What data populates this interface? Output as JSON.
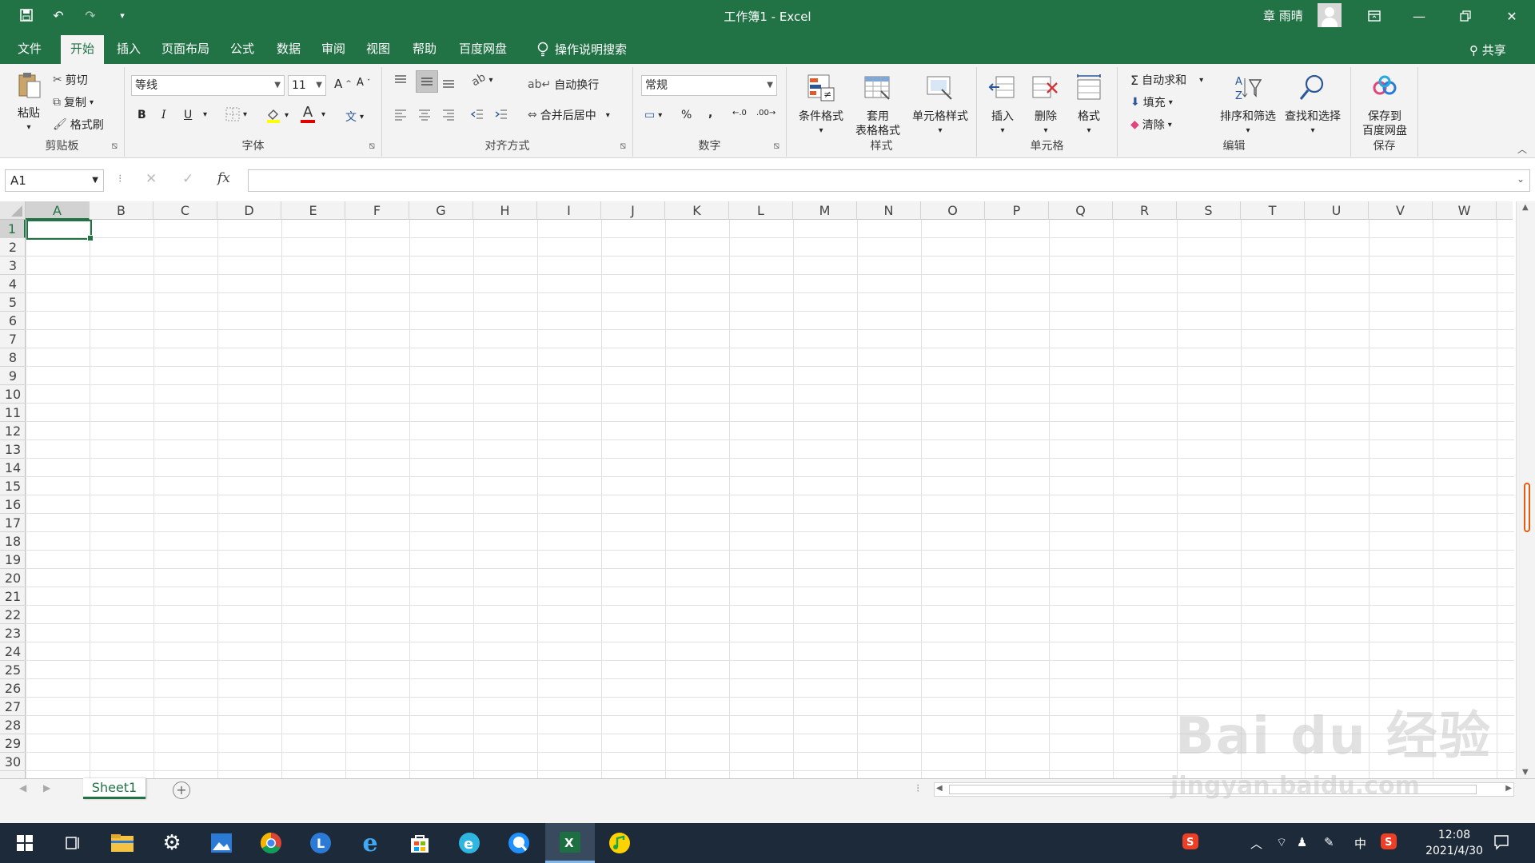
{
  "window": {
    "title": "工作簿1  -  Excel",
    "user": "章 雨晴"
  },
  "tabs": [
    "文件",
    "开始",
    "插入",
    "页面布局",
    "公式",
    "数据",
    "审阅",
    "视图",
    "帮助",
    "百度网盘"
  ],
  "tell_me": "操作说明搜索",
  "share": "共享",
  "ribbon": {
    "clipboard": {
      "label": "剪贴板",
      "paste": "粘贴",
      "cut": "剪切",
      "copy": "复制",
      "format_painter": "格式刷"
    },
    "font": {
      "label": "字体",
      "font_name": "等线",
      "font_size": "11",
      "bold": "B",
      "italic": "I",
      "underline": "U",
      "grow": "A",
      "shrink": "A",
      "wen": "文",
      "font_color_glyph": "A"
    },
    "alignment": {
      "label": "对齐方式",
      "wrap": "自动换行",
      "merge": "合并后居中"
    },
    "number": {
      "label": "数字",
      "format": "常规",
      "percent": "%",
      "comma": ","
    },
    "styles": {
      "label": "样式",
      "conditional": "条件格式",
      "table_line1": "套用",
      "table_line2": "表格格式",
      "cell_styles": "单元格样式"
    },
    "cells": {
      "label": "单元格",
      "insert": "插入",
      "delete": "删除",
      "format": "格式"
    },
    "editing": {
      "label": "编辑",
      "autosum": "自动求和",
      "fill": "填充",
      "clear": "清除",
      "sort": "排序和筛选",
      "find": "查找和选择"
    },
    "save": {
      "label": "保存",
      "line1": "保存到",
      "line2": "百度网盘"
    }
  },
  "formula_bar": {
    "name_box": "A1",
    "fx": "fx",
    "value": ""
  },
  "columns": [
    "A",
    "B",
    "C",
    "D",
    "E",
    "F",
    "G",
    "H",
    "I",
    "J",
    "K",
    "L",
    "M",
    "N",
    "O",
    "P",
    "Q",
    "R",
    "S",
    "T",
    "U",
    "V",
    "W"
  ],
  "rows": [
    "1",
    "2",
    "3",
    "4",
    "5",
    "6",
    "7",
    "8",
    "9",
    "10",
    "11",
    "12",
    "13",
    "14",
    "15",
    "16",
    "17",
    "18",
    "19",
    "20",
    "21",
    "22",
    "23",
    "24",
    "25",
    "26",
    "27",
    "28",
    "29",
    "30"
  ],
  "sheet": {
    "name": "Sheet1",
    "add": "+"
  },
  "taskbar": {
    "clock_time": "12:08",
    "clock_date": "2021/4/30",
    "ime": "中"
  },
  "watermark": {
    "brand": "Bai du 经验",
    "url": "jingyan.baidu.com"
  },
  "colors": {
    "excel_green": "#217346",
    "taskbar": "#1d2a3a"
  }
}
